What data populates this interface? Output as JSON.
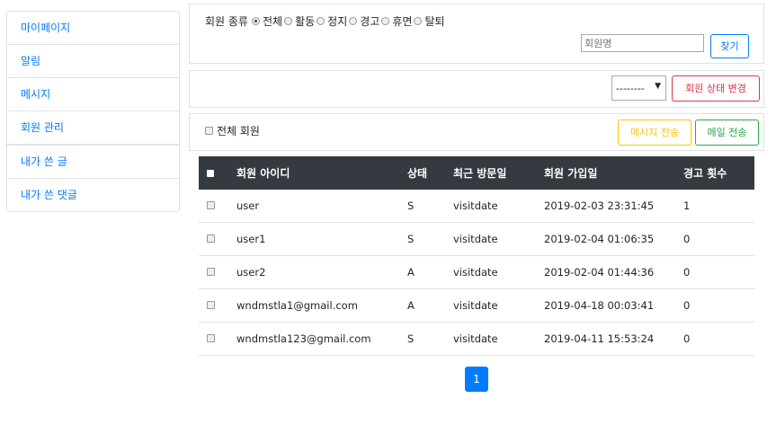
{
  "sidebar": {
    "items": [
      {
        "label": "마이페이지"
      },
      {
        "label": "알림"
      },
      {
        "label": "메시지"
      },
      {
        "label": "회원 관리"
      },
      {
        "label": "내가 쓴 글"
      },
      {
        "label": "내가 쓴 댓글"
      }
    ]
  },
  "filter": {
    "label": "회원 종류",
    "options": [
      "전체",
      "활동",
      "정지",
      "경고",
      "휴면",
      "탈퇴"
    ],
    "selected": "전체",
    "search_placeholder": "회원명",
    "search_button": "찾기"
  },
  "status_bar": {
    "select_value": "--------",
    "change_button": "회원 상태 변경"
  },
  "send_bar": {
    "all_members_label": "전체 회원",
    "message_button": "메시지 전송",
    "mail_button": "메일 전송"
  },
  "table": {
    "headers": [
      "회원 아이디",
      "상태",
      "최근 방문일",
      "회원 가입일",
      "경고 횟수"
    ],
    "rows": [
      [
        "user",
        "S",
        "visitdate",
        "2019-02-03 23:31:45",
        "1"
      ],
      [
        "user1",
        "S",
        "visitdate",
        "2019-02-04 01:06:35",
        "0"
      ],
      [
        "user2",
        "A",
        "visitdate",
        "2019-02-04 01:44:36",
        "0"
      ],
      [
        "wndmstla1@gmail.com",
        "A",
        "visitdate",
        "2019-04-18 00:03:41",
        "0"
      ],
      [
        "wndmstla123@gmail.com",
        "S",
        "visitdate",
        "2019-04-11 15:53:24",
        "0"
      ]
    ]
  },
  "pagination": {
    "current": "1"
  },
  "colors": {
    "primary": "#007bff",
    "danger": "#dc3545",
    "warning": "#ffc107",
    "success": "#28a745",
    "header_bg": "#343a40"
  }
}
